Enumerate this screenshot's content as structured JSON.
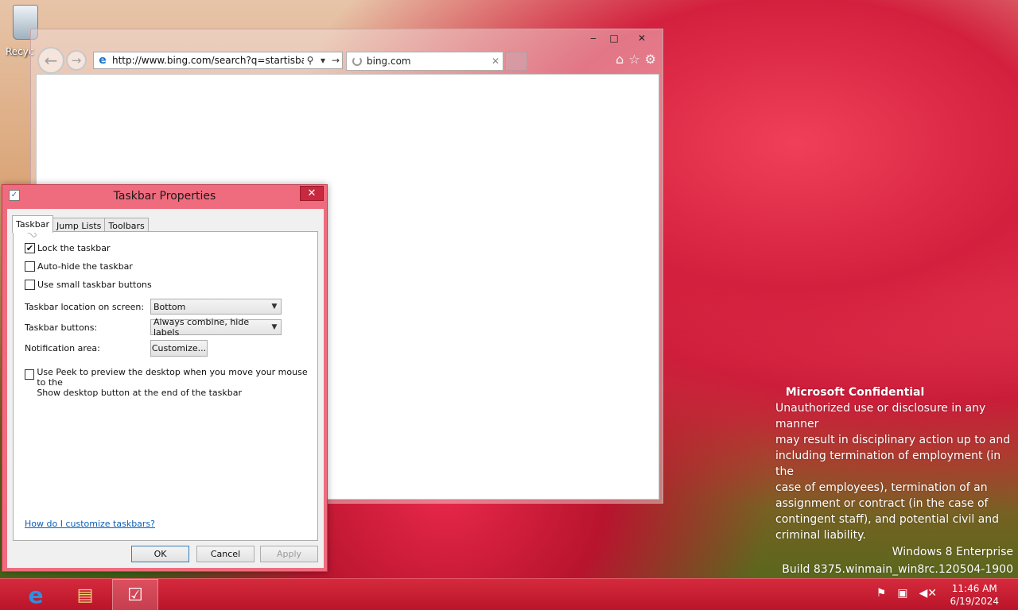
{
  "desktop": {
    "recycle_bin_label": "Recyc"
  },
  "browser": {
    "url": "http://www.bing.com/search?q=startisback+",
    "tab_title": "bing.com",
    "title_buttons": {
      "minimize": "‒",
      "maximize": "□",
      "close": "✕"
    }
  },
  "dialog": {
    "title": "Taskbar Properties",
    "close_label": "✕",
    "tabs": [
      "Taskbar",
      "Jump Lists",
      "Toolbars"
    ],
    "active_tab": "Taskbar",
    "checkboxes": {
      "lock": {
        "label": "Lock the taskbar",
        "checked": true
      },
      "autohide": {
        "label": "Auto-hide the taskbar",
        "checked": false
      },
      "small": {
        "label": "Use small taskbar buttons",
        "checked": false
      }
    },
    "location_label": "Taskbar location on screen:",
    "location_value": "Bottom",
    "buttons_label": "Taskbar buttons:",
    "buttons_value": "Always combine, hide labels",
    "notification_label": "Notification area:",
    "customize_label": "Customize...",
    "peek_line1": "Use Peek to preview the desktop when you move your mouse to the",
    "peek_line2": "Show desktop button at the end of the taskbar",
    "help_link": "How do I customize taskbars?",
    "ok_label": "OK",
    "cancel_label": "Cancel",
    "apply_label": "Apply"
  },
  "watermark": {
    "heading": "Microsoft Confidential",
    "lines": [
      "Unauthorized use or disclosure in any manner",
      "may result in disciplinary action up to and",
      "including termination of employment (in the",
      "case of employees), termination of an",
      "assignment or contract (in the case of",
      "contingent staff), and potential civil and",
      "criminal liability."
    ],
    "edition": "Windows 8 Enterprise",
    "build": "Build 8375.winmain_win8rc.120504-1900"
  },
  "taskbar": {
    "time": "11:46 AM",
    "date": "6/19/2024",
    "apps": [
      {
        "name": "internet-explorer",
        "glyph": "e"
      },
      {
        "name": "file-explorer",
        "glyph": "▤"
      },
      {
        "name": "taskbar-properties",
        "glyph": "☑"
      }
    ]
  }
}
